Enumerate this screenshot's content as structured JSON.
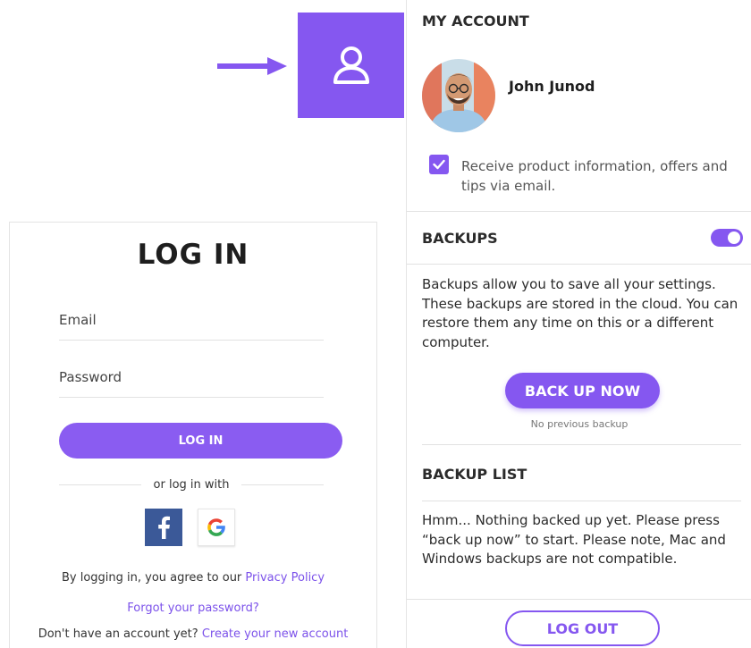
{
  "colors": {
    "accent": "#8557f0",
    "facebook": "#3b5998",
    "link": "#7c52ea"
  },
  "icons": {
    "arrow": "arrow-right-icon",
    "account": "user-icon",
    "facebook": "facebook-logo-icon",
    "google": "google-logo-icon",
    "checkbox": "checkmark-icon"
  },
  "login": {
    "title": "LOG IN",
    "email_label": "Email",
    "password_label": "Password",
    "button_label": "LOG IN",
    "or_text": "or log in with",
    "legal_prefix": "By logging in, you agree to our",
    "privacy_link": "Privacy Policy",
    "forgot_link": "Forgot your password?",
    "signup_prefix": "Don't have an account yet?",
    "signup_link": "Create your new account"
  },
  "account": {
    "title": "MY ACCOUNT",
    "user_name": "John Junod",
    "newsletter_checked": true,
    "newsletter_label": "Receive product information, offers and tips via email."
  },
  "backups": {
    "title": "BACKUPS",
    "enabled": true,
    "description": "Backups allow you to save all your settings. These backups are stored in the cloud. You can restore them any time on this or a different computer.",
    "button_label": "BACK UP NOW",
    "status": "No previous backup"
  },
  "backup_list": {
    "title": "BACKUP LIST",
    "empty_message": "Hmm... Nothing backed up yet. Please press “back up now” to start. Please note, Mac and Windows backups are not compatible."
  },
  "logout": {
    "button_label": "LOG OUT"
  }
}
